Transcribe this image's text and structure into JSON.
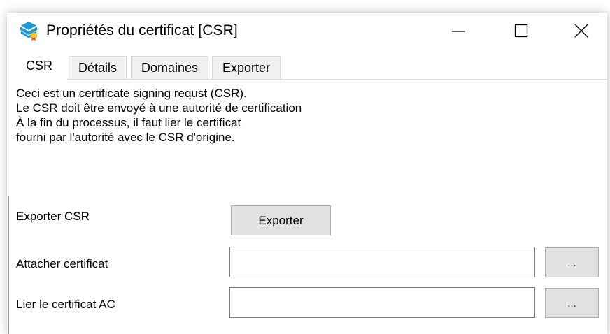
{
  "window": {
    "title": "Propriétés du certificat [CSR]",
    "app_icon": "envelope-certificate-icon",
    "controls": {
      "minimize_icon": "minimize-icon",
      "maximize_icon": "maximize-icon",
      "close_icon": "close-icon"
    }
  },
  "tabs": [
    {
      "label": "CSR",
      "active": true
    },
    {
      "label": "Détails",
      "active": false
    },
    {
      "label": "Domaines",
      "active": false
    },
    {
      "label": "Exporter",
      "active": false
    }
  ],
  "description": [
    "Ceci est un certificate signing requst (CSR).",
    "Le CSR doit être envoyé à une autorité de certification",
    "À la fin du processus, il faut lier le certificat",
    "fourni par l'autorité avec le CSR d'origine."
  ],
  "form": {
    "export_label": "Exporter CSR",
    "export_button": "Exporter",
    "attach_label": "Attacher certificat",
    "attach_value": "",
    "attach_browse": "...",
    "ca_label": "Lier le certificat AC",
    "ca_value": "",
    "ca_browse": "..."
  },
  "colors": {
    "icon_blue": "#1e9bd7",
    "button_face": "#e1e1e1",
    "button_border": "#adadad",
    "input_border": "#7a7a7a",
    "tab_inactive": "#f0f0f0"
  }
}
